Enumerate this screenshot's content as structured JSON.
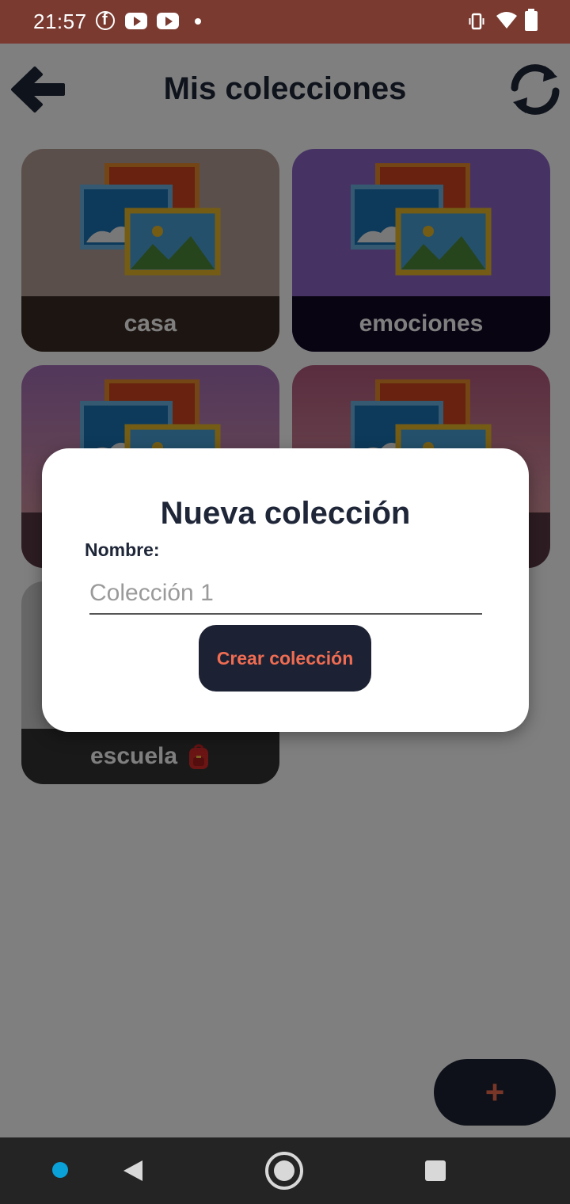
{
  "status_bar": {
    "time": "21:57",
    "icons": [
      "facebook-icon",
      "youtube-icon",
      "youtube-icon",
      "dot-icon",
      "vibrate-icon",
      "wifi-icon",
      "battery-icon"
    ]
  },
  "app_bar": {
    "title": "Mis colecciones",
    "back_icon": "arrow-left-icon",
    "refresh_icon": "refresh-icon"
  },
  "collections": [
    {
      "label": "casa",
      "icon": "pictures-icon"
    },
    {
      "label": "emociones",
      "icon": "pictures-icon"
    },
    {
      "label": "",
      "icon": "pictures-icon"
    },
    {
      "label": "",
      "icon": "pictures-icon"
    },
    {
      "label": "escuela",
      "icon": "backpack-icon"
    }
  ],
  "fab": {
    "label": "+"
  },
  "dialog": {
    "title": "Nueva colección",
    "field_label": "Nombre:",
    "placeholder": "Colección 1",
    "value": "",
    "button_label": "Crear colección"
  },
  "colors": {
    "status_bar": "#7a3a30",
    "dark_navy": "#1c2233",
    "accent_orange": "#f06c52",
    "title_text": "#1e2638"
  },
  "nav_bar": {
    "buttons": [
      "back-triangle-icon",
      "home-circle-icon",
      "recents-square-icon"
    ]
  }
}
